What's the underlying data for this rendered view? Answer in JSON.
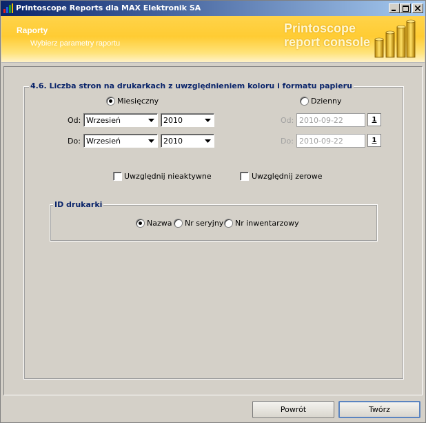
{
  "window": {
    "title": "Printoscope Reports dla MAX Elektronik SA",
    "controls": [
      "minimize",
      "maximize",
      "close"
    ]
  },
  "banner": {
    "heading": "Raporty",
    "subheading": "Wybierz parametry raportu",
    "brand_line1": "Printoscope",
    "brand_line2": "report console"
  },
  "report": {
    "title": "4.6. Liczba stron na drukarkach z uwzględnieniem koloru i formatu papieru",
    "mode_monthly": {
      "label": "Miesięczny",
      "checked": true
    },
    "mode_daily": {
      "label": "Dzienny",
      "checked": false
    },
    "monthly": {
      "from_label": "Od:",
      "to_label": "Do:",
      "from_month": "Wrzesień",
      "from_year": "2010",
      "to_month": "Wrzesień",
      "to_year": "2010"
    },
    "daily": {
      "from_label": "Od:",
      "to_label": "Do:",
      "from_date": "2010-09-22",
      "to_date": "2010-09-22",
      "calendar_glyph": "1"
    },
    "include_inactive": {
      "label": "Uwzględnij nieaktywne",
      "checked": false
    },
    "include_zero": {
      "label": "Uwzględnij zerowe",
      "checked": false
    }
  },
  "printer_id": {
    "title": "ID drukarki",
    "options": [
      {
        "label": "Nazwa",
        "checked": true
      },
      {
        "label": "Nr seryjny",
        "checked": false
      },
      {
        "label": "Nr inwentarzowy",
        "checked": false
      }
    ]
  },
  "footer": {
    "back_label": "Powrót",
    "create_label": "Twórz"
  },
  "colors": {
    "titlebar_start": "#0a246a",
    "titlebar_end": "#a6caf0",
    "banner": "#ffcc33",
    "group_title": "#0a246a"
  }
}
